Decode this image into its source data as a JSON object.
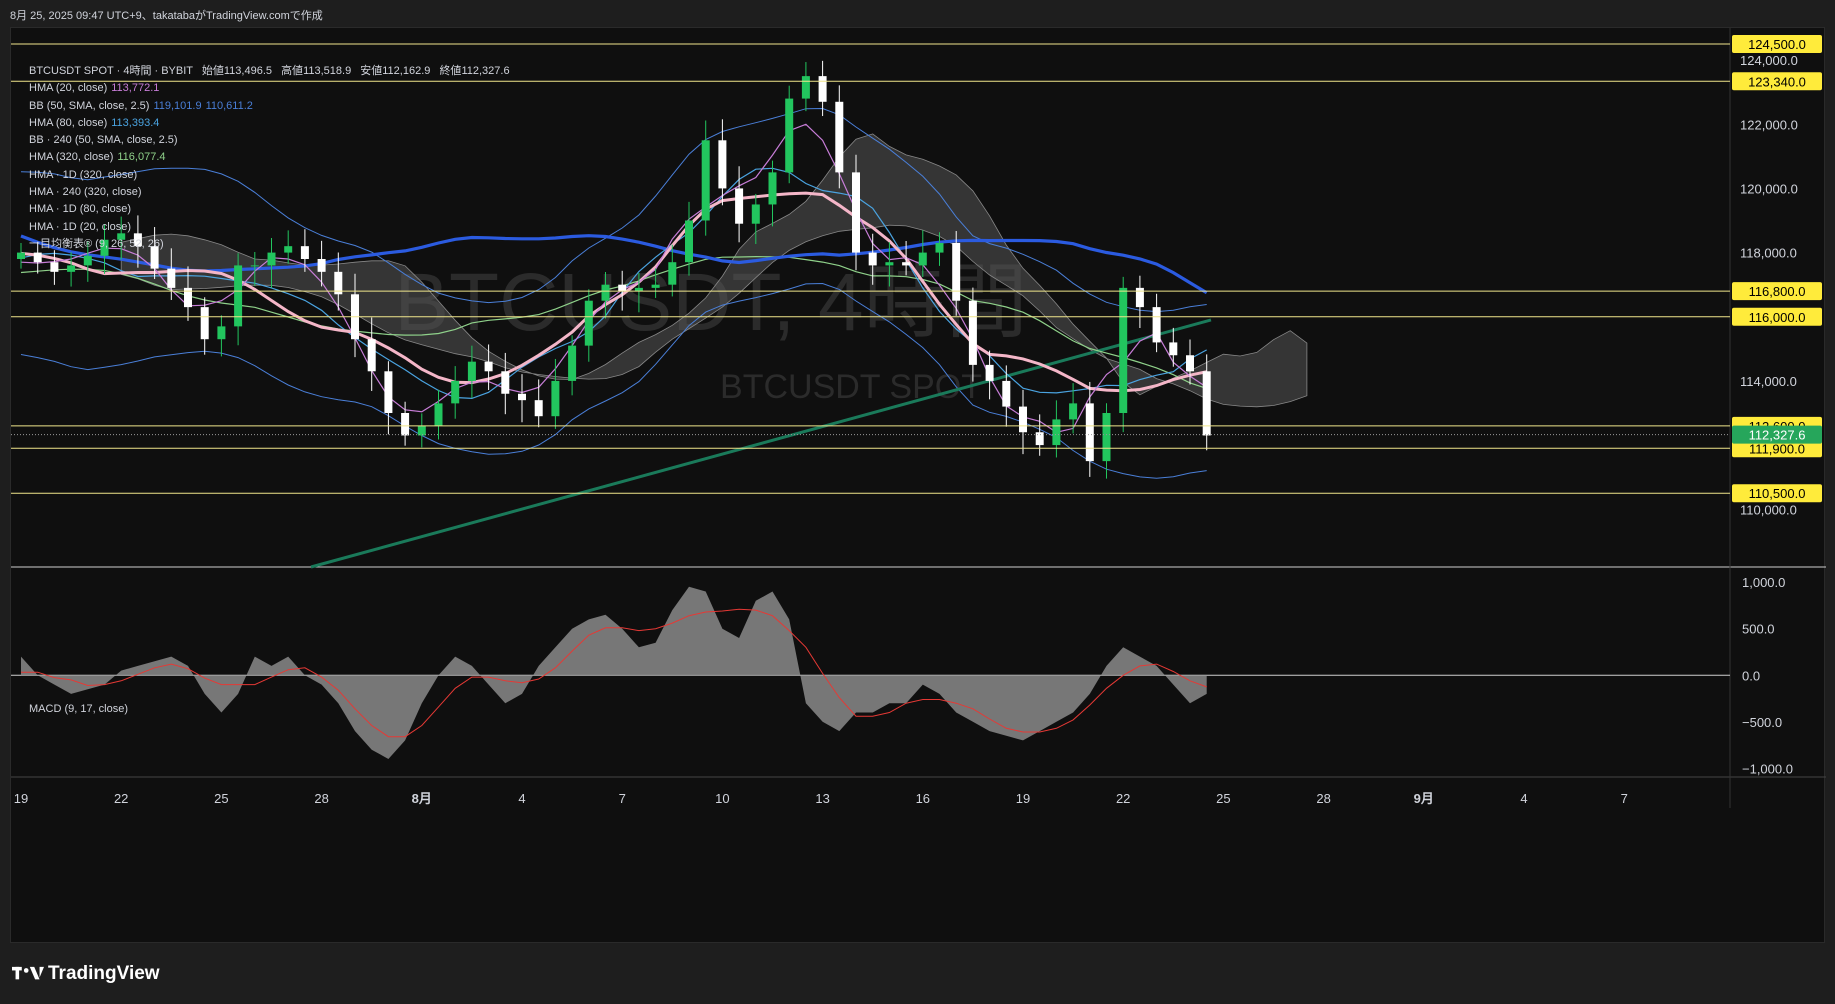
{
  "header": "8月 25, 2025 09:47 UTC+9、takatabaがTradingView.comで作成",
  "footer": {
    "brand": "TradingView"
  },
  "watermark": {
    "main": "BTCUSDT, 4時間",
    "sub": "BTCUSDT SPOT"
  },
  "legend": {
    "ticker": "BTCUSDT SPOT · 4時間 · BYBIT",
    "ohlc": [
      {
        "label": "始値",
        "value": "113,496.5"
      },
      {
        "label": "高値",
        "value": "113,518.9"
      },
      {
        "label": "安値",
        "value": "112,162.9"
      },
      {
        "label": "終値",
        "value": "112,327.6"
      }
    ],
    "indicators": [
      {
        "name": "HMA (20, close)",
        "values": [
          "113,772.1"
        ],
        "color": "#c77dd7"
      },
      {
        "name": "BB (50, SMA, close, 2.5)",
        "values": [
          "119,101.9",
          "110,611.2"
        ],
        "color": "#4a7fd8"
      },
      {
        "name": "HMA (80, close)",
        "values": [
          "113,393.4"
        ],
        "color": "#4aa3e0"
      },
      {
        "name": "BB · 240 (50, SMA, close, 2.5)",
        "values": [],
        "color": ""
      },
      {
        "name": "HMA (320, close)",
        "values": [
          "116,077.4"
        ],
        "color": "#8fd18a"
      },
      {
        "name": "HMA · 1D (320, close)",
        "values": [],
        "color": ""
      },
      {
        "name": "HMA · 240 (320, close)",
        "values": [],
        "color": ""
      },
      {
        "name": "HMA · 1D (80, close)",
        "values": [],
        "color": ""
      },
      {
        "name": "HMA · 1D (20, close)",
        "values": [],
        "color": ""
      },
      {
        "name": "一目均衡表® (9, 26, 52, 26)",
        "values": [],
        "color": ""
      }
    ]
  },
  "price_axis": {
    "ticks": [
      "124,000.0",
      "122,000.0",
      "120,000.0",
      "118,000.0",
      "114,000.0",
      "110,000.0"
    ],
    "levels": [
      "124,500.0",
      "123,340.0",
      "116,800.0",
      "116,000.0",
      "112,600.0",
      "111,900.0",
      "110,500.0"
    ],
    "current": "112,327.6"
  },
  "time_axis": {
    "labels": [
      "19",
      "22",
      "25",
      "28",
      "8月",
      "4",
      "7",
      "10",
      "13",
      "16",
      "19",
      "22",
      "25",
      "28",
      "9月",
      "4",
      "7"
    ]
  },
  "macd": {
    "label": "MACD (9, 17, close)",
    "ticks": [
      "1,000.0",
      "500.0",
      "0.0",
      "−500.0",
      "−1,000.0"
    ]
  },
  "colors": {
    "background": "#0f0f0f",
    "level_line": "#f0e68c",
    "level_badge": "#ffeb3b",
    "current_badge": "#26a65b",
    "candle_up": "#22c55e",
    "candle_down": "#ffffff",
    "hma20": "#c77dd7",
    "hma80": "#4aa3e0",
    "hma320": "#8fd18a",
    "hma1d80": "#2b5be0",
    "hma1d20": "#f4b6c8",
    "trendline": "#1a7a5a",
    "cloud": "#555555"
  },
  "chart_data": {
    "type": "candlestick",
    "symbol": "BTCUSDT",
    "timeframe": "4時間",
    "ylim": [
      108200,
      125000
    ],
    "x_labels": [
      "19",
      "22",
      "25",
      "28",
      "8月",
      "4",
      "7",
      "10",
      "13",
      "16",
      "19",
      "22",
      "25",
      "28",
      "9月",
      "4",
      "7"
    ],
    "closes": [
      118000,
      117700,
      117400,
      117600,
      117900,
      118400,
      118600,
      118200,
      117500,
      116900,
      116300,
      115300,
      115700,
      117600,
      117600,
      118000,
      118200,
      117800,
      117400,
      116700,
      115300,
      114300,
      113000,
      112300,
      112600,
      113300,
      114000,
      114600,
      114300,
      113600,
      113400,
      112900,
      114000,
      115100,
      116500,
      117000,
      116800,
      116900,
      117000,
      117700,
      119000,
      121500,
      120000,
      118900,
      119500,
      120500,
      122800,
      123500,
      122700,
      120500,
      118000,
      117600,
      117700,
      117600,
      118000,
      118300,
      116500,
      114500,
      114000,
      113200,
      112400,
      112000,
      112800,
      113300,
      111500,
      113000,
      116900,
      116300,
      115200,
      114800,
      114300,
      112300
    ],
    "level_lines": [
      124500,
      123340,
      116800,
      116000,
      112600,
      111900,
      110500
    ],
    "current_price": 112327.6,
    "macd": [
      200,
      0,
      -100,
      -200,
      -150,
      -100,
      50,
      100,
      150,
      200,
      100,
      -200,
      -400,
      -200,
      200,
      100,
      200,
      0,
      -100,
      -300,
      -600,
      -800,
      -900,
      -700,
      -300,
      0,
      200,
      100,
      -100,
      -300,
      -200,
      100,
      300,
      500,
      600,
      650,
      500,
      300,
      350,
      700,
      950,
      900,
      500,
      400,
      800,
      900,
      600,
      -300,
      -500,
      -600,
      -400,
      -400,
      -300,
      -300,
      -100,
      -200,
      -400,
      -500,
      -600,
      -650,
      -700,
      -600,
      -500,
      -400,
      -200,
      100,
      300,
      200,
      100,
      -100,
      -300,
      -200
    ],
    "macd_ylim": [
      -1050,
      1120
    ]
  }
}
